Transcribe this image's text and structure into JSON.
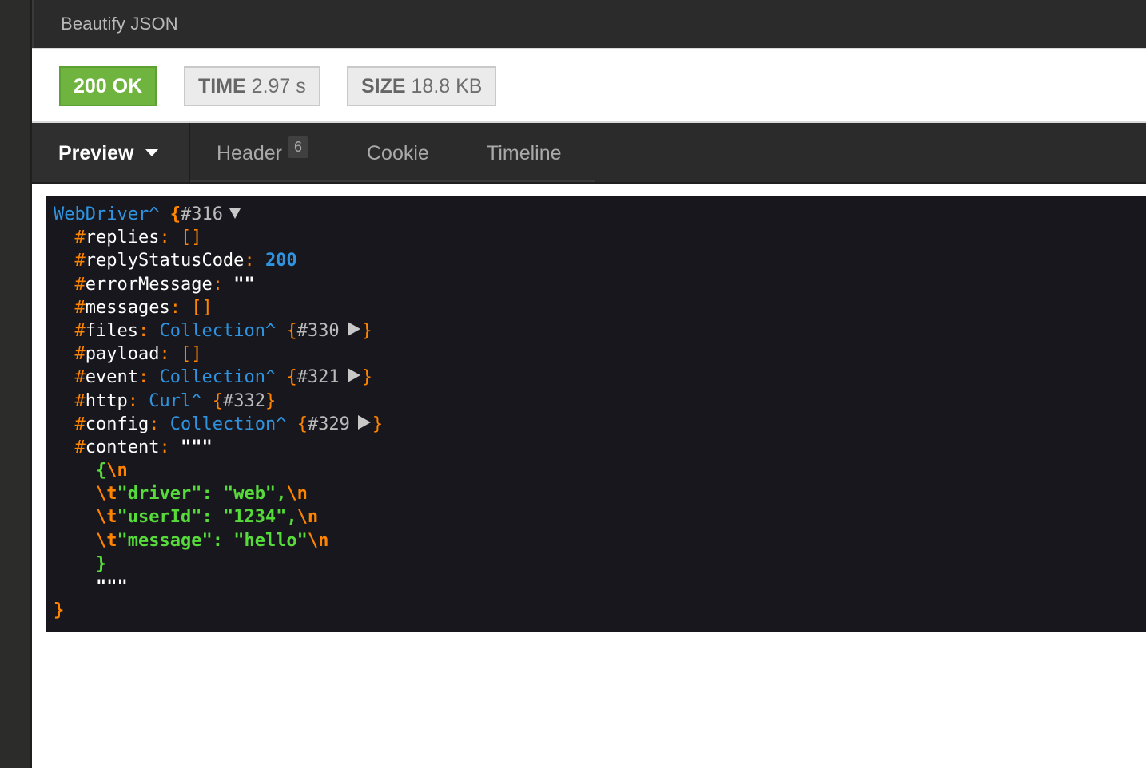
{
  "topbar": {
    "title": "Beautify JSON"
  },
  "status": {
    "code_label": "200 OK",
    "time_label": "TIME",
    "time_value": "2.97 s",
    "size_label": "SIZE",
    "size_value": "18.8 KB",
    "ok_color": "#6fb43f"
  },
  "tabs": {
    "preview": "Preview",
    "header": "Header",
    "header_count": "6",
    "cookie": "Cookie",
    "timeline": "Timeline"
  },
  "dump": {
    "root_class": "WebDriver^",
    "root_open": "{",
    "root_id": "#316",
    "root_close": "}",
    "props": [
      {
        "hash": "#",
        "name": "replies",
        "value": "[]"
      },
      {
        "hash": "#",
        "name": "replyStatusCode",
        "value": "200"
      },
      {
        "hash": "#",
        "name": "errorMessage",
        "value": "\"\""
      },
      {
        "hash": "#",
        "name": "messages",
        "value": "[]"
      },
      {
        "hash": "#",
        "name": "files",
        "class": "Collection^",
        "id": "#330"
      },
      {
        "hash": "#",
        "name": "payload",
        "value": "[]"
      },
      {
        "hash": "#",
        "name": "event",
        "class": "Collection^",
        "id": "#321"
      },
      {
        "hash": "#",
        "name": "http",
        "class": "Curl^",
        "id": "#332"
      },
      {
        "hash": "#",
        "name": "config",
        "class": "Collection^",
        "id": "#329"
      },
      {
        "hash": "#",
        "name": "content",
        "value": "\"\"\""
      }
    ],
    "content_lines": {
      "open": "{",
      "nl": "\\n",
      "tab": "\\t",
      "k1": "\"driver\"",
      "v1": "\"web\"",
      "k2": "\"userId\"",
      "v2": "\"1234\"",
      "k3": "\"message\"",
      "v3": "\"hello\"",
      "close": "}",
      "end_quotes": "\"\"\""
    }
  }
}
